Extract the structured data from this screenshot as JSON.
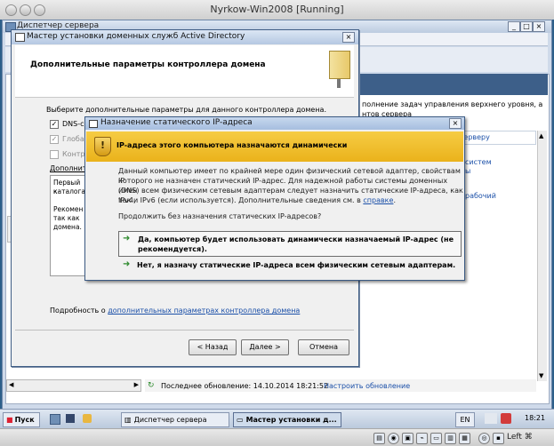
{
  "host": {
    "window_title": "Nyrkow-Win2008 [Running]",
    "keyboard": "Left ⌘"
  },
  "server_manager": {
    "title": "Диспетчер сервера",
    "description": "полнение задач управления верхнего уровня, а\nнтов сервера",
    "link_server": "серверу",
    "link_systems": "систем",
    "link_systems2": "ы",
    "link_workgroup": "рабочий",
    "last_update_label": "Последнее обновление: 14.10.2014 18:21:52",
    "refresh_link": "Настроить обновление"
  },
  "wizard": {
    "title": "Мастер установки доменных служб Active Directory",
    "header": "Дополнительные параметры контроллера домена",
    "instruction": "Выберите дополнительные параметры для данного контроллера домена.",
    "options": [
      {
        "label": "DNS-с",
        "checked": true
      },
      {
        "label": "Глоба",
        "checked": true
      },
      {
        "label": "Контр",
        "checked": false
      }
    ],
    "info_label": "Дополнит",
    "info_lines": [
      "Первый к",
      "каталога",
      "",
      "Рекомен",
      "так как",
      "домена."
    ],
    "more_info_prefix": "Подробность о ",
    "more_info_link": "дополнительных параметрах контроллера домена",
    "buttons": {
      "back": "< Назад",
      "next": "Далее >",
      "cancel": "Отмена"
    }
  },
  "ip_dialog": {
    "title": "Назначение статического IP-адреса",
    "warning": "IP-адреса этого компьютера назначаются динамически",
    "body_lines": [
      "Данный компьютер имеет по крайней мере один физический сетевой адаптер, свойствам IP",
      "которого не назначен статический IP-адрес. Для надежной работы системы доменных имен",
      "(DNS) всем физическим сетевым адаптерам следует назначить статические IP-адреса, как IPv4,"
    ],
    "body_last": "так и IPv6 (если используется). Дополнительные сведения см. в ",
    "help_link": "справке",
    "question": "Продолжить без назначения статических IP-адресов?",
    "option_yes_line1": "Да, компьютер будет использовать динамически назначаемый IP-адрес (не",
    "option_yes_line2": "рекомендуется).",
    "option_no": "Нет, я назначу статические IP-адреса всем физическим сетевым адаптерам."
  },
  "taskbar": {
    "start": "Пуск",
    "task_server_manager": "Диспетчер сервера",
    "task_wizard": "Мастер установки д...",
    "language": "EN",
    "time": "18:21"
  },
  "colors": {
    "warning_band": "#f0bd2c",
    "link": "#1a4fa8",
    "title_bar": "#b5c8e2"
  }
}
